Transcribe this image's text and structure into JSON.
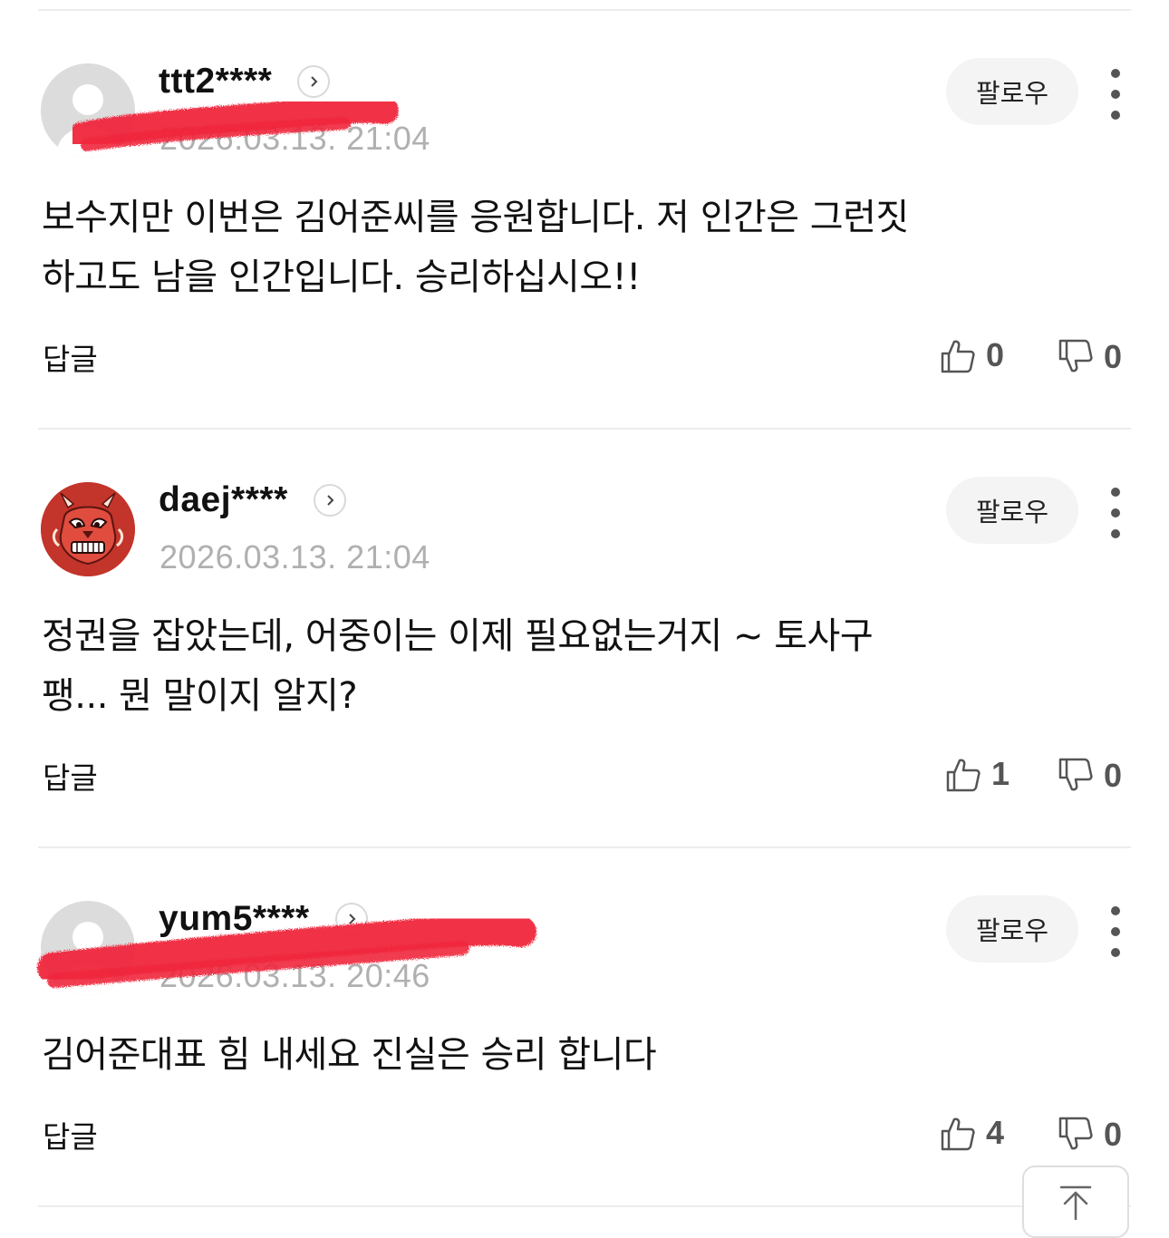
{
  "comments": [
    {
      "username": "ttt2****",
      "date": "2026.03.13. 21:04",
      "follow_label": "팔로우",
      "text_lines": [
        "보수지만 이번은 김어준씨를 응원합니다. 저 인간은 그런짓",
        "하고도 남을 인간입니다. 승리하십시오!!"
      ],
      "reply_label": "답글",
      "likes": "0",
      "dislikes": "0",
      "avatar": "default-avatar",
      "redacted": true
    },
    {
      "username": "daej****",
      "date": "2026.03.13. 21:04",
      "follow_label": "팔로우",
      "text_lines": [
        "정권을 잡았는데, 어중이는 이제 필요없는거지 ~ 토사구",
        "팽... 뭔 말이지 알지?"
      ],
      "reply_label": "답글",
      "likes": "1",
      "dislikes": "0",
      "avatar": "red-mask-avatar",
      "redacted": false
    },
    {
      "username": "yum5****",
      "date": "2026.03.13. 20:46",
      "follow_label": "팔로우",
      "text_lines": [
        "김어준대표 힘 내세요 진실은 승리 합니다"
      ],
      "reply_label": "답글",
      "likes": "4",
      "dislikes": "0",
      "avatar": "default-avatar",
      "redacted": true
    }
  ],
  "icons": {
    "profile_link": "chevron-right-icon",
    "more": "more-vertical-icon",
    "like": "thumbs-up-icon",
    "dislike": "thumbs-down-icon",
    "scroll_top": "arrow-up-to-top-icon"
  },
  "colors": {
    "redaction": "#f0283c",
    "date": "#b0b0b0",
    "follow_bg": "#f4f4f4",
    "divider": "#ececec"
  }
}
